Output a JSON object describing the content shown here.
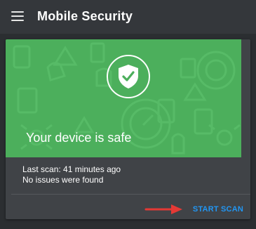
{
  "app": {
    "title": "Mobile Security"
  },
  "status": {
    "headline": "Your device is safe",
    "last_scan": "Last scan: 41 minutes ago",
    "issues": "No issues were found",
    "color": "#4caf5c"
  },
  "actions": {
    "start_scan_label": "START SCAN",
    "accent": "#2196f3"
  },
  "annotation": {
    "arrow_color": "#e53935"
  },
  "icons": {
    "menu": "hamburger-menu-icon",
    "status": "shield-check-icon",
    "annotation": "arrow-right-icon"
  }
}
